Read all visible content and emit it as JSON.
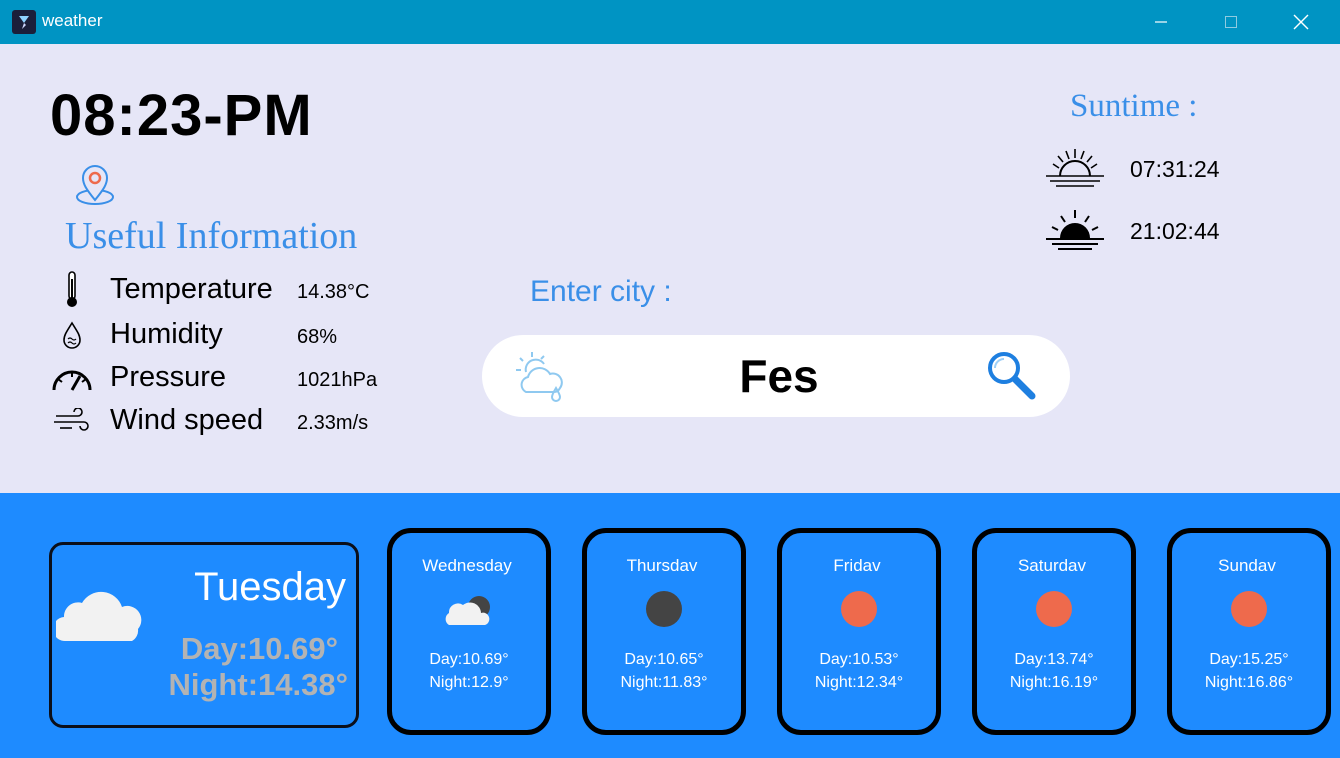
{
  "window": {
    "title": "weather"
  },
  "clock": "08:23-PM",
  "info": {
    "title": "Useful Information",
    "items": [
      {
        "label": "Temperature",
        "value": "14.38°C",
        "icon": "thermometer-icon"
      },
      {
        "label": "Humidity",
        "value": "68%",
        "icon": "humidity-drop-icon"
      },
      {
        "label": "Pressure",
        "value": "1021hPa",
        "icon": "gauge-icon"
      },
      {
        "label": "Wind speed",
        "value": "2.33m/s",
        "icon": "wind-icon"
      }
    ]
  },
  "suntime": {
    "title": "Suntime :",
    "sunrise": "07:31:24",
    "sunset": "21:02:44"
  },
  "search": {
    "label": "Enter city :",
    "value": "Fes"
  },
  "today": {
    "day": "Tuesday",
    "day_temp": "Day:10.69°",
    "night_temp": "Night:14.38°",
    "icon": "cloud-icon"
  },
  "forecast": [
    {
      "day": "Wednesday",
      "day_temp": "Day:10.69°",
      "night_temp": "Night:12.9°",
      "icon": "cloud-moon-icon"
    },
    {
      "day": "Thursdav",
      "day_temp": "Day:10.65°",
      "night_temp": "Night:11.83°",
      "icon": "moon-icon"
    },
    {
      "day": "Fridav",
      "day_temp": "Day:10.53°",
      "night_temp": "Night:12.34°",
      "icon": "sun-icon"
    },
    {
      "day": "Saturdav",
      "day_temp": "Day:13.74°",
      "night_temp": "Night:16.19°",
      "icon": "sun-icon"
    },
    {
      "day": "Sundav",
      "day_temp": "Day:15.25°",
      "night_temp": "Night:16.86°",
      "icon": "sun-icon"
    }
  ],
  "colors": {
    "titlebar": "#0094c3",
    "background": "#e6e6f7",
    "accent_text": "#3a8fe8",
    "forecast_panel": "#1e8bff",
    "sun": "#ee6a4c",
    "moon": "#444444"
  }
}
